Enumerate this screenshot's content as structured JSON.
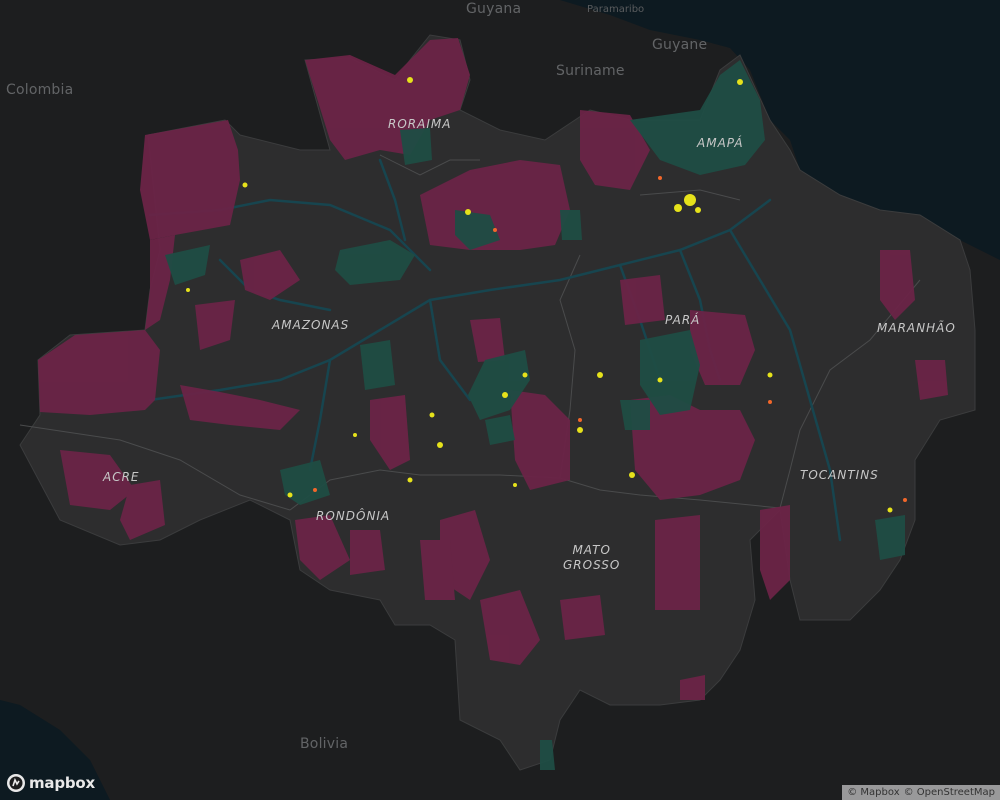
{
  "map": {
    "country_labels": [
      {
        "text": "Guyana"
      },
      {
        "text": "Guyane"
      },
      {
        "text": "Suriname"
      },
      {
        "text": "Colombia"
      },
      {
        "text": "Bolivia"
      }
    ],
    "city_labels": [
      {
        "text": "Paramaribo"
      }
    ],
    "state_labels": [
      {
        "text": "RORAIMA"
      },
      {
        "text": "AMAPÁ"
      },
      {
        "text": "AMAZONAS"
      },
      {
        "text": "PARÁ"
      },
      {
        "text": "MARANHÃO"
      },
      {
        "text": "ACRE"
      },
      {
        "text": "TOCANTINS"
      },
      {
        "text": "RONDÔNIA"
      },
      {
        "text": "MATO",
        "text2": "GROSSO"
      }
    ],
    "colors": {
      "background": "#1b1c1d",
      "ocean": "#0d1a21",
      "region_fill": "#2d2d2e",
      "indigenous_land": "#6b2447",
      "protected_area": "#1f4d44",
      "fire_alert": "#e6e21b",
      "deforestation_alert": "#f2672a",
      "rivers": "#17454f"
    }
  },
  "branding": {
    "logo_text": "mapbox",
    "attribution": [
      "© Mapbox",
      "© OpenStreetMap"
    ]
  }
}
